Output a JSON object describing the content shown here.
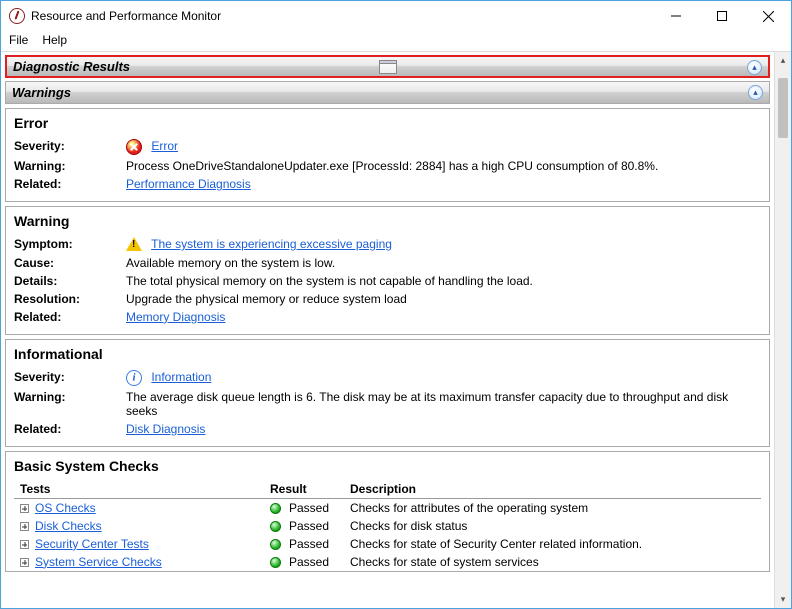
{
  "window": {
    "title": "Resource and Performance Monitor"
  },
  "menubar": {
    "file": "File",
    "help": "Help"
  },
  "banners": {
    "diag": "Diagnostic Results",
    "warnings": "Warnings"
  },
  "labels": {
    "severity": "Severity:",
    "warning": "Warning:",
    "related": "Related:",
    "symptom": "Symptom:",
    "cause": "Cause:",
    "details": "Details:",
    "resolution": "Resolution:"
  },
  "error_panel": {
    "heading": "Error",
    "severity_text": "Error",
    "warning_text": "Process OneDriveStandaloneUpdater.exe [ProcessId: 2884] has a high CPU consumption of 80.8%.",
    "related_link": "Performance Diagnosis"
  },
  "warning_panel": {
    "heading": "Warning",
    "symptom_text": "The system is experiencing excessive paging",
    "cause_text": "Available memory on the system is low.",
    "details_text": "The total physical memory on the system is not capable of handling the load.",
    "resolution_text": "Upgrade the physical memory or reduce system load",
    "related_link": "Memory Diagnosis"
  },
  "info_panel": {
    "heading": "Informational",
    "severity_text": "Information",
    "warning_text": "The average disk queue length is 6. The disk may be at its maximum transfer capacity due to throughput and disk seeks",
    "related_link": "Disk Diagnosis"
  },
  "checks": {
    "heading": "Basic System Checks",
    "columns": {
      "tests": "Tests",
      "result": "Result",
      "description": "Description"
    },
    "rows": [
      {
        "test": "OS Checks",
        "result": "Passed",
        "desc": "Checks for attributes of the operating system"
      },
      {
        "test": "Disk Checks",
        "result": "Passed",
        "desc": "Checks for disk status"
      },
      {
        "test": "Security Center Tests",
        "result": "Passed",
        "desc": "Checks for state of Security Center related information."
      },
      {
        "test": "System Service Checks",
        "result": "Passed",
        "desc": "Checks for state of system services"
      }
    ]
  }
}
